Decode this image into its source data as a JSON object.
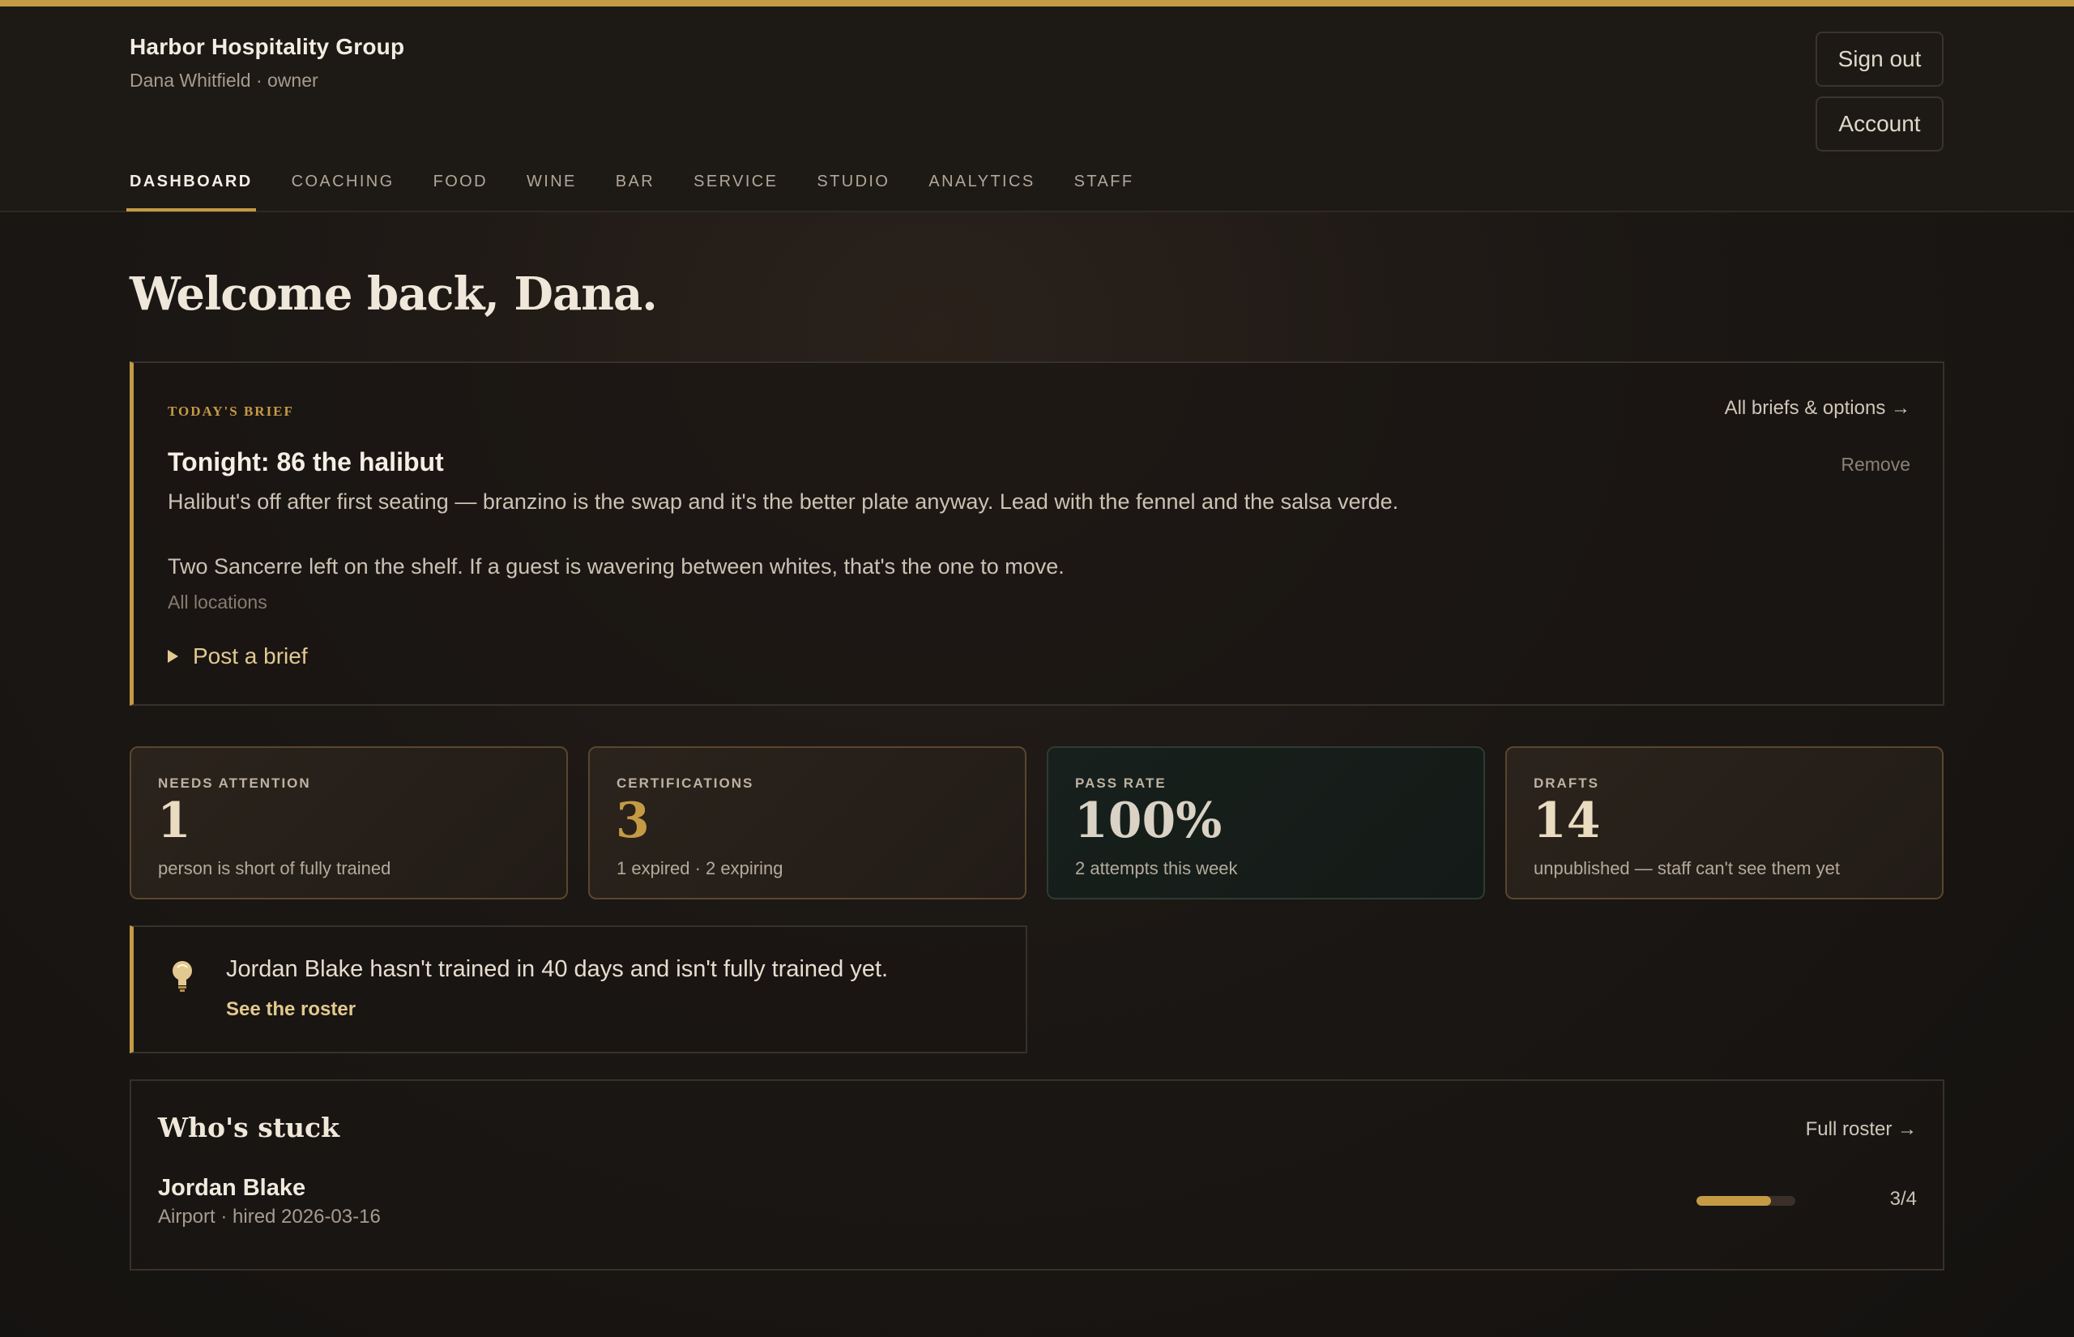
{
  "org": {
    "name": "Harbor Hospitality Group",
    "user": "Dana Whitfield · owner"
  },
  "header": {
    "sign_out": "Sign out",
    "account": "Account"
  },
  "nav": {
    "tabs": [
      {
        "label": "DASHBOARD",
        "active": true
      },
      {
        "label": "COACHING"
      },
      {
        "label": "FOOD"
      },
      {
        "label": "WINE"
      },
      {
        "label": "BAR"
      },
      {
        "label": "SERVICE"
      },
      {
        "label": "STUDIO"
      },
      {
        "label": "ANALYTICS"
      },
      {
        "label": "STAFF"
      }
    ]
  },
  "welcome": "Welcome back, Dana.",
  "brief": {
    "label": "TODAY'S BRIEF",
    "all_link": "All briefs & options →",
    "title": "Tonight: 86 the halibut",
    "remove": "Remove",
    "paragraph1": "Halibut's off after first seating — branzino is the swap and it's the better plate anyway. Lead with the fennel and the salsa verde.",
    "paragraph2": "Two Sancerre left on the shelf. If a guest is wavering between whites, that's the one to move.",
    "scope": "All locations",
    "post": "Post a brief"
  },
  "stats": [
    {
      "label": "NEEDS ATTENTION",
      "value": "1",
      "sub": "person is short of fully trained",
      "color": "#e9dcc0"
    },
    {
      "label": "CERTIFICATIONS",
      "value": "3",
      "sub": "1 expired · 2 expiring",
      "color": "#c49a45"
    },
    {
      "label": "PASS RATE",
      "value": "100%",
      "sub": "2 attempts this week",
      "color": "#d9d2c5"
    },
    {
      "label": "DRAFTS",
      "value": "14",
      "sub": "unpublished — staff can't see them yet",
      "color": "#e9dcc0"
    }
  ],
  "tip": {
    "icon": "lightbulb-icon",
    "text": "Jordan Blake hasn't trained in 40 days and isn't fully trained yet.",
    "link": "See the roster"
  },
  "stuck": {
    "title": "Who's stuck",
    "link": "Full roster →",
    "rows": [
      {
        "name": "Jordan Blake",
        "meta": "Airport · hired 2026-03-16",
        "progress": 0.75,
        "count": "3/4"
      }
    ]
  },
  "colors": {
    "accent": "#c49a45",
    "background": "#1b1714"
  }
}
